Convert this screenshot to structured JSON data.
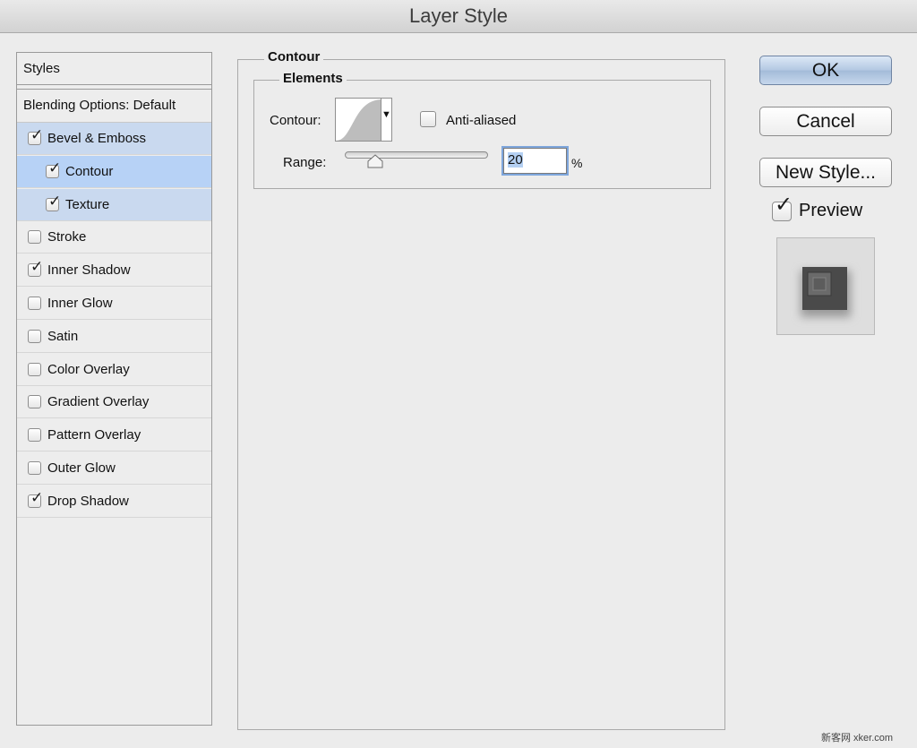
{
  "window": {
    "title": "Layer Style"
  },
  "styles_panel": {
    "header": "Styles",
    "blending_options": "Blending Options: Default",
    "items": [
      {
        "label": "Bevel & Emboss",
        "checked": true,
        "level": 0,
        "state": "selected-parent"
      },
      {
        "label": "Contour",
        "checked": true,
        "level": 1,
        "state": "active"
      },
      {
        "label": "Texture",
        "checked": true,
        "level": 1,
        "state": "selected-child"
      },
      {
        "label": "Stroke",
        "checked": false,
        "level": 0,
        "state": "normal"
      },
      {
        "label": "Inner Shadow",
        "checked": true,
        "level": 0,
        "state": "normal"
      },
      {
        "label": "Inner Glow",
        "checked": false,
        "level": 0,
        "state": "normal"
      },
      {
        "label": "Satin",
        "checked": false,
        "level": 0,
        "state": "normal"
      },
      {
        "label": "Color Overlay",
        "checked": false,
        "level": 0,
        "state": "normal"
      },
      {
        "label": "Gradient Overlay",
        "checked": false,
        "level": 0,
        "state": "normal"
      },
      {
        "label": "Pattern Overlay",
        "checked": false,
        "level": 0,
        "state": "normal"
      },
      {
        "label": "Outer Glow",
        "checked": false,
        "level": 0,
        "state": "normal"
      },
      {
        "label": "Drop Shadow",
        "checked": true,
        "level": 0,
        "state": "normal"
      }
    ]
  },
  "contour_section": {
    "title": "Contour",
    "elements_title": "Elements",
    "contour_label": "Contour:",
    "anti_aliased_label": "Anti-aliased",
    "anti_aliased_checked": false,
    "range_label": "Range:",
    "range_value": "20",
    "range_unit": "%"
  },
  "buttons": {
    "ok": "OK",
    "cancel": "Cancel",
    "new_style": "New Style..."
  },
  "preview": {
    "label": "Preview",
    "checked": true
  },
  "watermark": "新客网 xker.com"
}
